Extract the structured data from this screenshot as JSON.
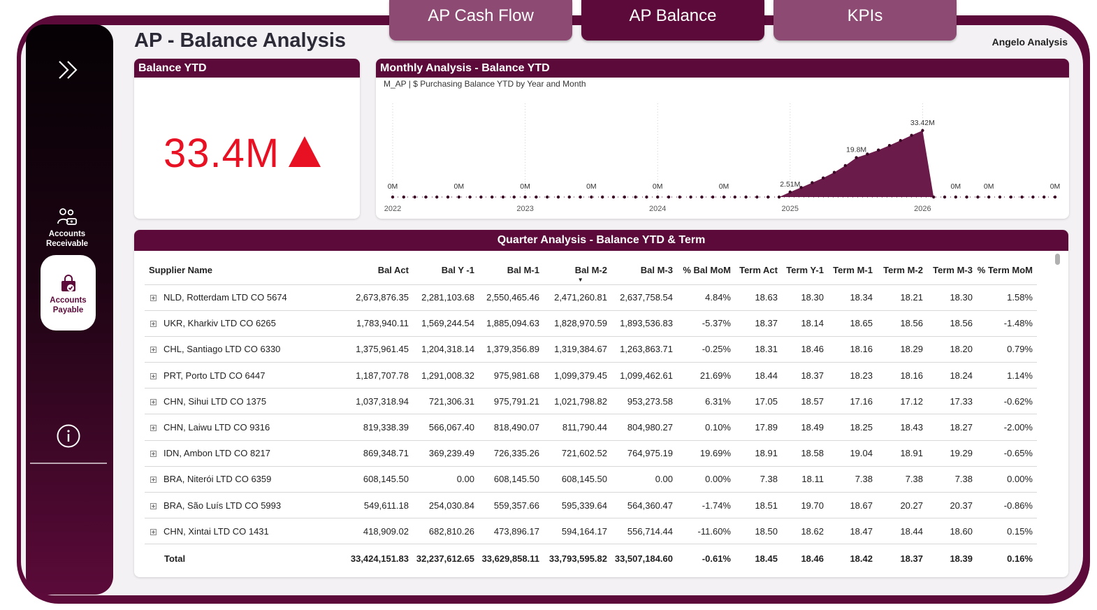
{
  "nav": {
    "tabs": [
      {
        "label": "AP Cash Flow"
      },
      {
        "label": "AP Balance"
      },
      {
        "label": "KPIs"
      }
    ],
    "active_tab": "AP Balance"
  },
  "sidebar": {
    "items": [
      {
        "icon": "double-chevron-right-icon"
      },
      {
        "icon": "people-money-icon",
        "label_line1": "Accounts",
        "label_line2": "Receivable"
      },
      {
        "icon": "shopping-bag-icon",
        "label_line1": "Accounts",
        "label_line2": "Payable",
        "selected": true
      },
      {
        "icon": "info-icon"
      }
    ]
  },
  "header": {
    "title": "AP - Balance Analysis",
    "author": "Angelo Analysis"
  },
  "kpi": {
    "title": "Balance YTD",
    "value": "33.4M",
    "trend_icon": "triangle-up-icon",
    "color": "#e81123"
  },
  "colors": {
    "brand": "#5c0a3a",
    "tab_inactive": "#8d4a72",
    "area_fill": "#6b1b4a"
  },
  "chart": {
    "title": "Monthly Analysis - Balance YTD",
    "subtitle": "M_AP | $ Purchasing Balance YTD by Year and Month"
  },
  "chart_data": {
    "type": "area",
    "x_ticks": [
      "2022",
      "2023",
      "2024",
      "2025",
      "2026"
    ],
    "data_labels": [
      {
        "index": 0,
        "label": "0M"
      },
      {
        "index": 6,
        "label": "0M"
      },
      {
        "index": 12,
        "label": "0M"
      },
      {
        "index": 18,
        "label": "0M"
      },
      {
        "index": 24,
        "label": "0M"
      },
      {
        "index": 30,
        "label": "0M"
      },
      {
        "index": 36,
        "label": "2.51M"
      },
      {
        "index": 42,
        "label": "19.8M"
      },
      {
        "index": 48,
        "label": "33.42M"
      },
      {
        "index": 51,
        "label": "0M"
      },
      {
        "index": 54,
        "label": "0M"
      },
      {
        "index": 60,
        "label": "0M"
      }
    ],
    "series": [
      {
        "values": [
          0,
          0,
          0,
          0,
          0,
          0,
          0,
          0,
          0,
          0,
          0,
          0,
          0,
          0,
          0,
          0,
          0,
          0,
          0,
          0,
          0,
          0,
          0,
          0,
          0,
          0,
          0,
          0,
          0,
          0,
          0,
          0,
          0,
          0,
          0,
          0,
          2.51,
          4.8,
          7.2,
          9.6,
          12.4,
          15.8,
          19.8,
          21.6,
          23.6,
          25.9,
          28.4,
          31.0,
          33.42,
          0,
          0,
          0,
          0,
          0,
          0,
          0,
          0,
          0,
          0,
          0,
          0
        ]
      }
    ],
    "ylim": [
      0,
      40
    ],
    "grid": false
  },
  "table": {
    "title": "Quarter Analysis - Balance YTD & Term",
    "columns": [
      "Supplier Name",
      "Bal Act",
      "Bal Y -1",
      "Bal M-1",
      "Bal M-2",
      "Bal M-3",
      "% Bal MoM",
      "Term Act",
      "Term Y-1",
      "Term M-1",
      "Term M-2",
      "Term M-3",
      "% Term MoM"
    ],
    "rows": [
      [
        "NLD, Rotterdam LTD CO 5674",
        "2,673,876.35",
        "2,281,103.68",
        "2,550,465.46",
        "2,471,260.81",
        "2,637,758.54",
        "4.84%",
        "18.63",
        "18.30",
        "18.34",
        "18.21",
        "18.30",
        "1.58%"
      ],
      [
        "UKR, Kharkiv LTD CO 6265",
        "1,783,940.11",
        "1,569,244.54",
        "1,885,094.63",
        "1,828,970.59",
        "1,893,536.83",
        "-5.37%",
        "18.37",
        "18.14",
        "18.65",
        "18.56",
        "18.56",
        "-1.48%"
      ],
      [
        "CHL, Santiago LTD CO 6330",
        "1,375,961.45",
        "1,204,318.14",
        "1,379,356.89",
        "1,319,384.67",
        "1,263,863.71",
        "-0.25%",
        "18.31",
        "18.46",
        "18.16",
        "18.29",
        "18.20",
        "0.79%"
      ],
      [
        "PRT, Porto LTD CO 6447",
        "1,187,707.78",
        "1,291,008.32",
        "975,981.68",
        "1,099,379.45",
        "1,099,462.61",
        "21.69%",
        "18.44",
        "18.37",
        "18.23",
        "18.16",
        "18.24",
        "1.14%"
      ],
      [
        "CHN, Sihui LTD CO 1375",
        "1,037,318.94",
        "721,306.31",
        "975,791.21",
        "1,021,798.82",
        "953,273.58",
        "6.31%",
        "17.05",
        "18.57",
        "17.16",
        "17.12",
        "17.33",
        "-0.62%"
      ],
      [
        "CHN, Laiwu LTD CO 9316",
        "819,338.39",
        "566,067.40",
        "818,490.07",
        "811,790.44",
        "804,980.27",
        "0.10%",
        "17.89",
        "18.49",
        "18.25",
        "18.43",
        "18.27",
        "-2.00%"
      ],
      [
        "IDN, Ambon LTD CO 8217",
        "869,348.71",
        "369,239.49",
        "726,335.26",
        "721,602.52",
        "764,975.19",
        "19.69%",
        "18.91",
        "18.58",
        "19.04",
        "18.91",
        "19.29",
        "-0.65%"
      ],
      [
        "BRA, Niterói LTD CO 6359",
        "608,145.50",
        "0.00",
        "608,145.50",
        "608,145.50",
        "0.00",
        "0.00%",
        "7.38",
        "18.11",
        "7.38",
        "7.38",
        "7.38",
        "0.00%"
      ],
      [
        "BRA, São Luís LTD CO 5993",
        "549,611.18",
        "254,030.84",
        "559,357.66",
        "595,339.64",
        "564,360.47",
        "-1.74%",
        "18.51",
        "19.70",
        "18.67",
        "20.27",
        "20.37",
        "-0.86%"
      ],
      [
        "CHN, Xintai LTD CO 1431",
        "418,909.02",
        "682,810.26",
        "473,896.17",
        "594,164.17",
        "556,714.44",
        "-11.60%",
        "18.50",
        "18.62",
        "18.47",
        "18.44",
        "18.60",
        "0.15%"
      ]
    ],
    "total": [
      "Total",
      "33,424,151.83",
      "32,237,612.65",
      "33,629,858.11",
      "33,793,595.82",
      "33,507,184.60",
      "-0.61%",
      "18.45",
      "18.46",
      "18.42",
      "18.37",
      "18.39",
      "0.16%"
    ]
  }
}
